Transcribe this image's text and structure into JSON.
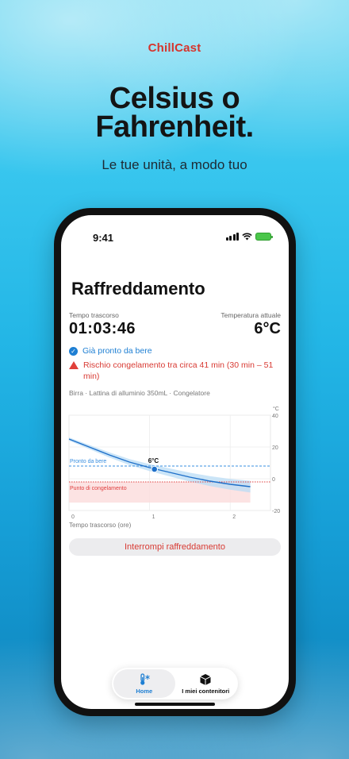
{
  "brand": "ChillCast",
  "headline_line1": "Celsius o",
  "headline_line2": "Fahrenheit.",
  "subhead": "Le tue unità, a modo tuo",
  "status_bar": {
    "time": "9:41"
  },
  "screen": {
    "title": "Raffreddamento",
    "elapsed_label": "Tempo trascorso",
    "elapsed_value": "01:03:46",
    "temp_label": "Temperatura attuale",
    "temp_value": "6°C",
    "ready_text": "Già pronto da bere",
    "warning_text": "Rischio congelamento tra circa 41 min (30 min – 51 min)",
    "meta": "Birra · Lattina di alluminio 350mL · Congelatore",
    "x_axis_label": "Tempo trascorso (ore)",
    "stop_button": "Interrompi raffreddamento"
  },
  "chart_data": {
    "type": "line",
    "unit": "°C",
    "xlim": [
      0,
      2.5
    ],
    "ylim": [
      -20,
      40
    ],
    "x_ticks": [
      "0",
      "1",
      "2"
    ],
    "y_ticks": [
      "40",
      "20",
      "0",
      "-20"
    ],
    "series": [
      {
        "x": [
          0,
          0.25,
          0.5,
          0.75,
          1.0,
          1.25,
          1.5,
          1.75,
          2.0,
          2.25
        ],
        "y": [
          25,
          20,
          15,
          10.5,
          7,
          4,
          1,
          -1.5,
          -3.5,
          -5
        ]
      }
    ],
    "current_point": {
      "x": 1.06,
      "y": 6,
      "label": "6°C"
    },
    "ready_line": {
      "y": 8,
      "label": "Pronto da bere"
    },
    "freeze_line": {
      "y": -2,
      "label": "Punto di congelamento"
    },
    "colors": {
      "line": "#1e6fc9",
      "ready": "#3a8fe0",
      "freeze": "#e04040"
    }
  },
  "tabbar": {
    "home_label": "Home",
    "containers_label": "I miei contenitori"
  },
  "icons": {
    "home": "thermometer-snowflake-icon",
    "containers": "box-icon"
  }
}
